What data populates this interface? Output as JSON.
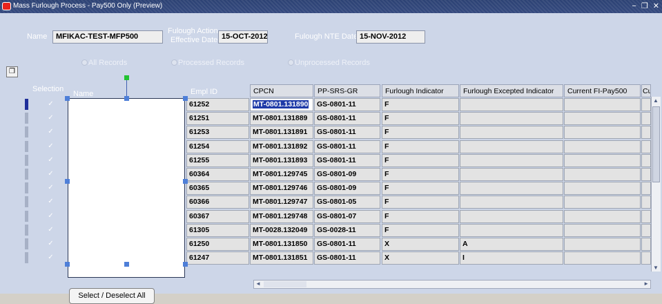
{
  "window": {
    "title": "Mass Furlough Process - Pay500 Only (Preview)",
    "controls": "− ❐ ✕"
  },
  "header": {
    "name_label": "Name",
    "name_value": "MFIKAC-TEST-MFP500",
    "action_label_1": "Fulough Action",
    "action_label_2": "Effective Date",
    "action_value": "15-OCT-2012",
    "nte_label": "Fulough NTE Date",
    "nte_value": "15-NOV-2012"
  },
  "radios": [
    {
      "label": "All Records"
    },
    {
      "label": "Processed Records"
    },
    {
      "label": "Unprocessed Records"
    }
  ],
  "table": {
    "selection_header": "Selection",
    "name_header": "Name",
    "empl_header": "Empl ID",
    "columns": [
      "CPCN",
      "PP-SRS-GR",
      "Furlough Indicator",
      "Furlough Excepted Indicator",
      "Current FI-Pay500",
      "Cu"
    ],
    "rows": [
      {
        "selected": "✓",
        "empl": "61252",
        "cpcn": "MT-0801.131890",
        "pp": "GS-0801-11",
        "fi": "F",
        "fei": "",
        "cur": ""
      },
      {
        "selected": "✓",
        "empl": "61251",
        "cpcn": "MT-0801.131889",
        "pp": "GS-0801-11",
        "fi": "F",
        "fei": "",
        "cur": ""
      },
      {
        "selected": "✓",
        "empl": "61253",
        "cpcn": "MT-0801.131891",
        "pp": "GS-0801-11",
        "fi": "F",
        "fei": "",
        "cur": ""
      },
      {
        "selected": "✓",
        "empl": "61254",
        "cpcn": "MT-0801.131892",
        "pp": "GS-0801-11",
        "fi": "F",
        "fei": "",
        "cur": ""
      },
      {
        "selected": "✓",
        "empl": "61255",
        "cpcn": "MT-0801.131893",
        "pp": "GS-0801-11",
        "fi": "F",
        "fei": "",
        "cur": ""
      },
      {
        "selected": "✓",
        "empl": "60364",
        "cpcn": "MT-0801.129745",
        "pp": "GS-0801-09",
        "fi": "F",
        "fei": "",
        "cur": ""
      },
      {
        "selected": "✓",
        "empl": "60365",
        "cpcn": "MT-0801.129746",
        "pp": "GS-0801-09",
        "fi": "F",
        "fei": "",
        "cur": ""
      },
      {
        "selected": "✓",
        "empl": "60366",
        "cpcn": "MT-0801.129747",
        "pp": "GS-0801-05",
        "fi": "F",
        "fei": "",
        "cur": ""
      },
      {
        "selected": "✓",
        "empl": "60367",
        "cpcn": "MT-0801.129748",
        "pp": "GS-0801-07",
        "fi": "F",
        "fei": "",
        "cur": ""
      },
      {
        "selected": "✓",
        "empl": "61305",
        "cpcn": "MT-0028.132049",
        "pp": "GS-0028-11",
        "fi": "F",
        "fei": "",
        "cur": ""
      },
      {
        "selected": "✓",
        "empl": "61250",
        "cpcn": "MT-0801.131850",
        "pp": "GS-0801-11",
        "fi": "X",
        "fei": "A",
        "cur": ""
      },
      {
        "selected": "✓",
        "empl": "61247",
        "cpcn": "MT-0801.131851",
        "pp": "GS-0801-11",
        "fi": "X",
        "fei": "I",
        "cur": ""
      }
    ]
  },
  "scrollbars": {
    "up": "▲",
    "down": "▼",
    "left": "◄",
    "right": "►"
  },
  "folder_icon": "❐",
  "select_button": "Select / Deselect  All"
}
